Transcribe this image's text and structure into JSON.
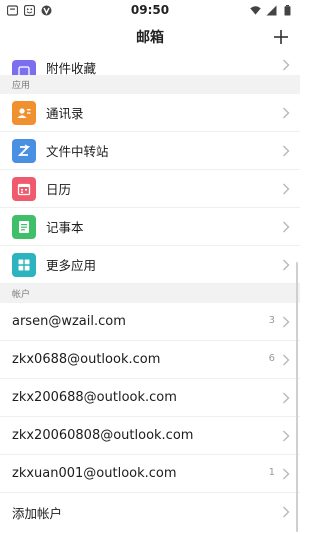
{
  "status_bar": {
    "time": "09:50",
    "left_icons": [
      "message-icon",
      "face-icon",
      "vpn-icon"
    ],
    "right_icons": [
      "wifi-icon",
      "signal-icon",
      "battery-icon"
    ]
  },
  "header": {
    "title": "邮箱",
    "add_symbol": "+"
  },
  "top_partial_item": {
    "label": "附件收藏",
    "icon": "attachment-icon",
    "color": "#6c63ff"
  },
  "apps_section": {
    "header": "应用",
    "items": [
      {
        "label": "通讯录",
        "icon": "contacts-icon",
        "color": "#f0902e"
      },
      {
        "label": "文件中转站",
        "icon": "file-transfer-icon",
        "color": "#4a90e2"
      },
      {
        "label": "日历",
        "icon": "calendar-icon",
        "color": "#ef5b6c"
      },
      {
        "label": "记事本",
        "icon": "notes-icon",
        "color": "#3fbf6a"
      },
      {
        "label": "更多应用",
        "icon": "more-apps-icon",
        "color": "#2bb3c0"
      }
    ]
  },
  "accounts_section": {
    "header": "帐户",
    "accounts": [
      {
        "email": "arsen@wzail.com",
        "count": "3"
      },
      {
        "email": "zkx0688@outlook.com",
        "count": "6"
      },
      {
        "email": "zkx200688@outlook.com",
        "count": ""
      },
      {
        "email": "zkx20060808@outlook.com",
        "count": ""
      },
      {
        "email": "zkxuan001@outlook.com",
        "count": "1"
      }
    ],
    "add_account": "添加帐户"
  }
}
